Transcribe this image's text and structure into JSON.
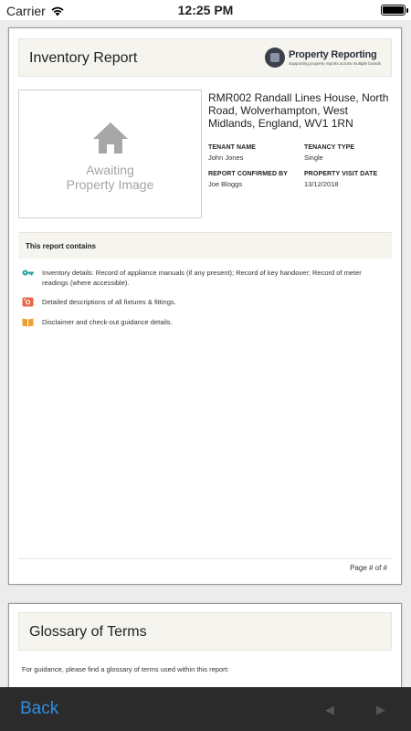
{
  "status_bar": {
    "carrier": "Carrier",
    "time": "12:25 PM"
  },
  "page1": {
    "title": "Inventory Report",
    "brand": {
      "name": "Property Reporting",
      "tagline": "Supporting property reports across multiple brands"
    },
    "image_placeholder": {
      "line1": "Awaiting",
      "line2": "Property Image"
    },
    "address": "RMR002 Randall Lines House, North Road, Wolverhampton, West Midlands, England, WV1 1RN",
    "tenant_name": {
      "label": "TENANT NAME",
      "value": "John Jones"
    },
    "tenancy_type": {
      "label": "TENANCY TYPE",
      "value": "Single"
    },
    "report_confirmed_by": {
      "label": "REPORT CONFIRMED BY",
      "value": "Joe Bloggs"
    },
    "property_visit_date": {
      "label": "PROPERTY VISIT DATE",
      "value": "13/12/2018"
    },
    "contains_title": "This report contains",
    "contains_items": [
      {
        "icon": "key-icon",
        "text": "Inventory details: Record of appliance manuals (if any present); Record of key handover; Record of meter readings (where accessible).",
        "color": "#1aa3a0"
      },
      {
        "icon": "camera-icon",
        "text": "Detailed descriptions of all fixtures & fittings.",
        "color": "#e8694a"
      },
      {
        "icon": "book-icon",
        "text": "Disclaimer and check-out guidance details.",
        "color": "#f0a030"
      }
    ],
    "page_number": "Page # of #"
  },
  "page2": {
    "title": "Glossary of Terms",
    "intro": "For guidance, please find a glossary of terms used within this report:"
  },
  "toolbar": {
    "back_label": "Back",
    "prev_icon": "◀",
    "next_icon": "▶"
  },
  "colors": {
    "accent": "#2f8ee3",
    "toolbar": "#2b2b2b",
    "header_bg": "#f5f4ef"
  }
}
